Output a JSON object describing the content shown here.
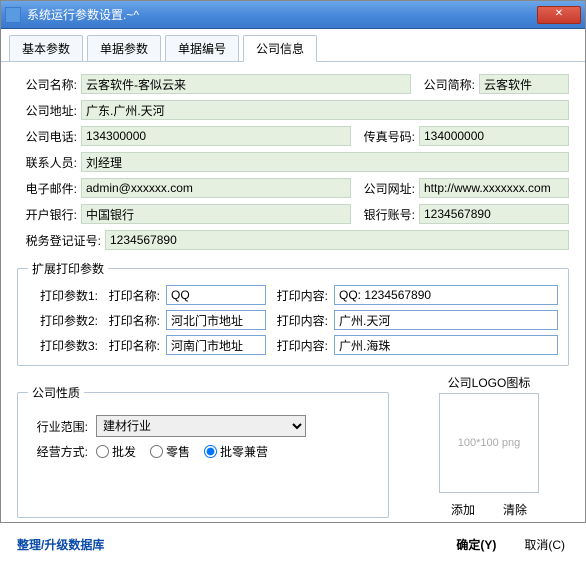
{
  "window": {
    "title": "系统运行参数设置.~^",
    "close": "✕"
  },
  "tabs": {
    "t0": "基本参数",
    "t1": "单据参数",
    "t2": "单据编号",
    "t3": "公司信息"
  },
  "labels": {
    "companyName": "公司名称:",
    "companyShort": "公司简称:",
    "companyAddr": "公司地址:",
    "companyTel": "公司电话:",
    "fax": "传真号码:",
    "contact": "联系人员:",
    "email": "电子邮件:",
    "website": "公司网址:",
    "bank": "开户银行:",
    "account": "银行账号:",
    "taxNo": "税务登记证号:",
    "ext": "扩展打印参数",
    "p1": "打印参数1:",
    "p2": "打印参数2:",
    "p3": "打印参数3:",
    "pname": "打印名称:",
    "pcontent": "打印内容:",
    "nature": "公司性质",
    "industry": "行业范围:",
    "mode": "经营方式:",
    "r1": "批发",
    "r2": "零售",
    "r3": "批零兼营",
    "logoTitle": "公司LOGO图标",
    "logoHint": "100*100 png",
    "add": "添加",
    "clear": "清除"
  },
  "values": {
    "companyName": "云客软件-客似云来",
    "companyShort": "云客软件",
    "companyAddr": "广东.广州.天河",
    "companyTel": "134300000",
    "fax": "134000000",
    "contact": "刘经理",
    "email": "admin@xxxxxx.com",
    "website": "http://www.xxxxxxx.com",
    "bank": "中国银行",
    "account": "1234567890",
    "taxNo": "1234567890",
    "pn1": "QQ",
    "pc1": "QQ: 1234567890",
    "pn2": "河北门市地址",
    "pc2": "广州.天河",
    "pn3": "河南门市地址",
    "pc3": "广州.海珠",
    "industry": "建材行业"
  },
  "footer": {
    "link": "整理/升级数据库",
    "ok": "确定(Y)",
    "cancel": "取消(C)"
  }
}
